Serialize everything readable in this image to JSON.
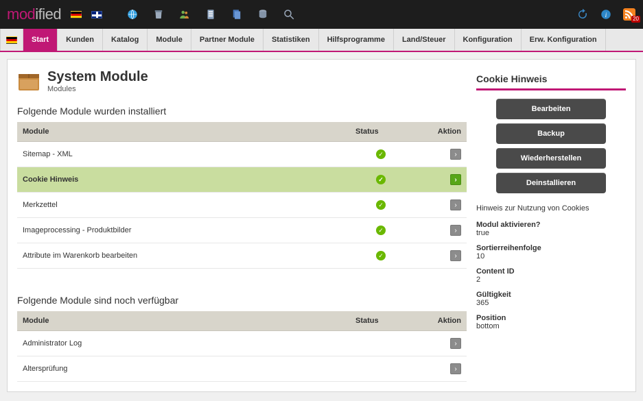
{
  "logo": {
    "part1": "mod",
    "part2": "ified"
  },
  "rss_count": "20",
  "menu": [
    {
      "label": "Start",
      "active": true
    },
    {
      "label": "Kunden"
    },
    {
      "label": "Katalog"
    },
    {
      "label": "Module"
    },
    {
      "label": "Partner Module"
    },
    {
      "label": "Statistiken"
    },
    {
      "label": "Hilfsprogramme"
    },
    {
      "label": "Land/Steuer"
    },
    {
      "label": "Konfiguration"
    },
    {
      "label": "Erw. Konfiguration"
    }
  ],
  "page": {
    "title": "System Module",
    "subtitle": "Modules"
  },
  "installed_heading": "Folgende Module wurden installiert",
  "available_heading": "Folgende Module sind noch verfügbar",
  "table_headers": {
    "module": "Module",
    "status": "Status",
    "aktion": "Aktion"
  },
  "installed": [
    {
      "name": "Sitemap - XML",
      "status": true,
      "selected": false
    },
    {
      "name": "Cookie Hinweis",
      "status": true,
      "selected": true
    },
    {
      "name": "Merkzettel",
      "status": true,
      "selected": false
    },
    {
      "name": "Imageprocessing - Produktbilder",
      "status": true,
      "selected": false
    },
    {
      "name": "Attribute im Warenkorb bearbeiten",
      "status": true,
      "selected": false
    }
  ],
  "available": [
    {
      "name": "Administrator Log"
    },
    {
      "name": "Altersprüfung"
    }
  ],
  "side": {
    "title": "Cookie Hinweis",
    "buttons": {
      "edit": "Bearbeiten",
      "backup": "Backup",
      "restore": "Wiederherstellen",
      "uninstall": "Deinstallieren"
    },
    "description": "Hinweis zur Nutzung von Cookies",
    "props": [
      {
        "key": "Modul aktivieren?",
        "val": "true"
      },
      {
        "key": "Sortierreihenfolge",
        "val": "10"
      },
      {
        "key": "Content ID",
        "val": "2"
      },
      {
        "key": "Gültigkeit",
        "val": "365"
      },
      {
        "key": "Position",
        "val": "bottom"
      }
    ]
  }
}
